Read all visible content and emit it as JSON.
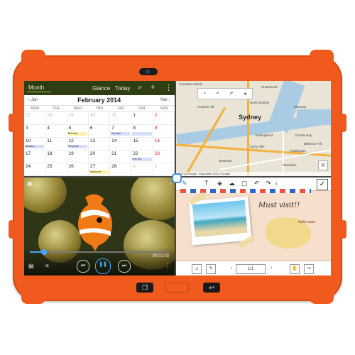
{
  "calendar": {
    "view_selector": "Month",
    "glance_label": "Glance",
    "today_label": "Today",
    "search_icon": "search-icon",
    "add_icon": "plus-icon",
    "menu_icon": "overflow-menu-icon",
    "prev_month": "Jan",
    "current_month": "February 2014",
    "next_month": "Mar",
    "weekdays": [
      "MON",
      "TUE",
      "WED",
      "THU",
      "FRI",
      "SAT",
      "SUN"
    ],
    "days": [
      {
        "d": "27",
        "dim": true
      },
      {
        "d": "28",
        "dim": true
      },
      {
        "d": "29",
        "dim": true
      },
      {
        "d": "30",
        "dim": true
      },
      {
        "d": "31",
        "dim": true
      },
      {
        "d": "1"
      },
      {
        "d": "2",
        "red": true
      },
      {
        "d": "3"
      },
      {
        "d": "4"
      },
      {
        "d": "5",
        "evt": "Birthday",
        "y": true
      },
      {
        "d": "6"
      },
      {
        "d": "7",
        "evt": "Vacation"
      },
      {
        "d": "8",
        "evt": ""
      },
      {
        "d": "9",
        "red": true
      },
      {
        "d": "10",
        "evt": "Vacation"
      },
      {
        "d": "11"
      },
      {
        "d": "12",
        "evt": "Proposal"
      },
      {
        "d": "13"
      },
      {
        "d": "14"
      },
      {
        "d": "15"
      },
      {
        "d": "16",
        "red": true
      },
      {
        "d": "17"
      },
      {
        "d": "18"
      },
      {
        "d": "19"
      },
      {
        "d": "20"
      },
      {
        "d": "21"
      },
      {
        "d": "22",
        "evt": "Get Set"
      },
      {
        "d": "23",
        "red": true
      },
      {
        "d": "24"
      },
      {
        "d": "25"
      },
      {
        "d": "26"
      },
      {
        "d": "27",
        "evt": "Jamboree",
        "y": true
      },
      {
        "d": "28"
      },
      {
        "d": "1",
        "dim": true
      },
      {
        "d": "2",
        "dim": true
      }
    ]
  },
  "map": {
    "city_label": "Sydney",
    "place_labels": [
      "Cockatoo Island",
      "Hunters Hill",
      "Chatswood",
      "Mosman",
      "North Sydney",
      "Double Bay",
      "Paddington",
      "Darlinghurst",
      "Surry Hills",
      "Bellevue Hill",
      "Randwick",
      "Newtown"
    ],
    "copyright": "©2014 Google · Map data ©2014 Google"
  },
  "video": {
    "elapsed": "00:01:03",
    "progress": 0.1
  },
  "note": {
    "title_text": "Must visit!!",
    "map_note": "Gold coast",
    "page_indicator": "1/1"
  }
}
